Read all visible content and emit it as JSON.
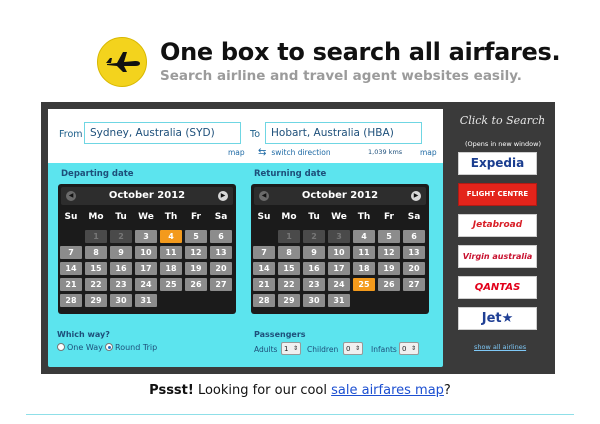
{
  "header": {
    "title": "One box to search all airfares.",
    "subtitle": "Search airline and travel agent websites easily."
  },
  "route": {
    "from_label": "From",
    "from_value": "Sydney, Australia (SYD)",
    "to_label": "To",
    "to_value": "Hobart, Australia (HBA)",
    "map_link": "map",
    "switch_label": "switch direction",
    "distance": "1,039 kms"
  },
  "departing": {
    "label": "Departing date",
    "month": "October 2012",
    "selected": "4"
  },
  "returning": {
    "label": "Returning date",
    "month": "October 2012",
    "selected": "25"
  },
  "weekdays": [
    "Su",
    "Mo",
    "Tu",
    "We",
    "Th",
    "Fr",
    "Sa"
  ],
  "which_way": {
    "label": "Which way?",
    "one_way": "One Way",
    "round_trip": "Round Trip",
    "selected": "Round Trip"
  },
  "passengers": {
    "label": "Passengers",
    "adults_label": "Adults",
    "adults": "1",
    "children_label": "Children",
    "children": "0",
    "infants_label": "Infants",
    "infants": "0"
  },
  "sidebar": {
    "title": "Click to Search",
    "opens_note": "(Opens in new window)",
    "airlines": [
      {
        "name": "Expedia",
        "color": "#1a3d8f"
      },
      {
        "name": "FLIGHT CENTRE",
        "color": "#ffffff"
      },
      {
        "name": "Jetabroad",
        "color": "#d81e26"
      },
      {
        "name": "Virgin australia",
        "color": "#c8102e"
      },
      {
        "name": "QANTAS",
        "color": "#e2001a"
      },
      {
        "name": "Jet★",
        "color": "#1f3f95"
      }
    ],
    "show_all": "show all airlines"
  },
  "footer": {
    "psst": "Pssst!",
    "lead": "Looking for our cool",
    "link": "sale airfares map",
    "end": "?"
  },
  "colors": {
    "panel": "#5ce4ee",
    "frame": "#3a3a3a",
    "selected_day": "#f39a1c",
    "logo": "#f3d31d"
  }
}
